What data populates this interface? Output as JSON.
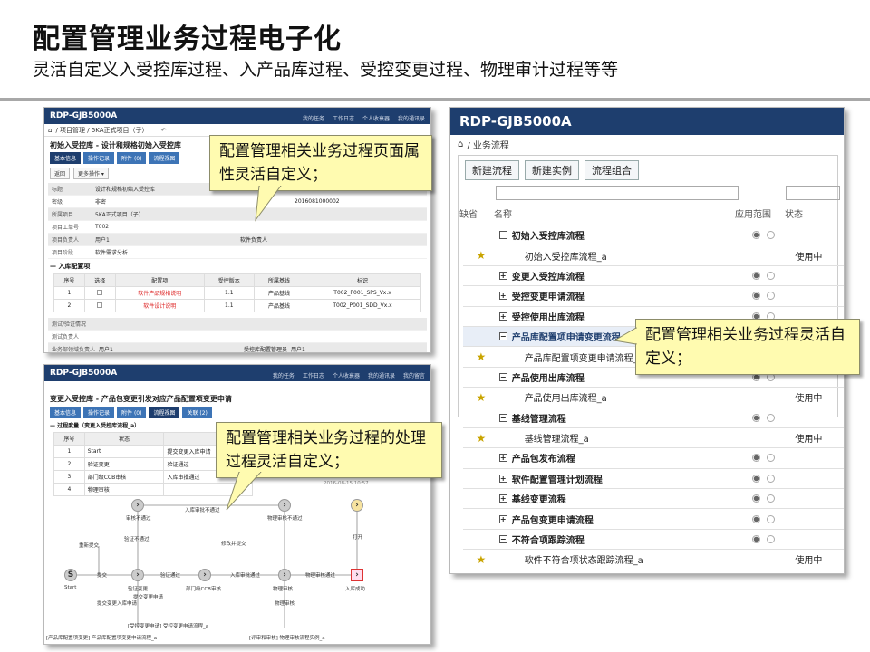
{
  "slide": {
    "title": "配置管理业务过程电子化",
    "subtitle": "灵活自定义入受控库过程、入产品库过程、受控变更过程、物理审计过程等等"
  },
  "app": {
    "name": "RDP-GJB5000A",
    "nav": [
      "我的任务",
      "工作日志",
      "个人收衰器",
      "我的通讯录",
      "我的留言"
    ]
  },
  "s1": {
    "crumb": "/ 项目管理 / 5KA正式项目（子）",
    "title": "初始入受控库 - 设计和规格初始入受控库",
    "tabs": [
      "基本信息",
      "操作记录",
      "附件 (0)",
      "流程视图"
    ],
    "buttons": [
      "返回",
      "更多操作 ▾"
    ],
    "fields": [
      {
        "label": "标题",
        "value": "设计和规格初始入受控库"
      },
      {
        "label": "密级",
        "value": "非密",
        "extra": "2016081000002"
      },
      {
        "label": "所属项目",
        "value": "5KA正式项目（子）"
      },
      {
        "label": "项目工单号",
        "value": "T002"
      },
      {
        "label": "项目负责人",
        "value": "用户1",
        "r_label": "软件负责人"
      },
      {
        "label": "项目阶段",
        "value": "软件需求分析"
      }
    ],
    "section": "入库配置项",
    "table": {
      "headers": [
        "序号",
        "选择",
        "配置项",
        "受控版本",
        "所属基线",
        "标识"
      ],
      "rows": [
        [
          "1",
          "",
          "软件产品规格说明",
          "1.1",
          "产品基线",
          "T002_P001_SPS_Vx.x"
        ],
        [
          "2",
          "",
          "软件设计说明",
          "1.1",
          "产品基线",
          "T002_P001_SDD_Vx.x"
        ]
      ]
    },
    "foot": [
      {
        "label": "测试/验证情况"
      },
      {
        "label": "测试负责人"
      },
      {
        "label": "业务部领域负责人",
        "value": "用户1",
        "r_label": "受控库配置管理员",
        "r_value": "用户1"
      }
    ]
  },
  "s2": {
    "title": "变更入受控库 - 产品包变更引发对应产品配置项变更申请",
    "tabs": [
      "基本信息",
      "操作记录",
      "附件 (0)",
      "流程视图",
      "关联 (2)"
    ],
    "section": "过程度量（变更入受控库流程_a）",
    "table": {
      "headers": [
        "序号",
        "状态"
      ],
      "rows": [
        [
          "1",
          "Start",
          "提交变更入库申请"
        ],
        [
          "2",
          "验证变更",
          "验证通过"
        ],
        [
          "3",
          "部门级CCB审核",
          "入库审批通过"
        ],
        [
          "4",
          "物理审核",
          ""
        ]
      ]
    },
    "ts": "2016-08-15 10:57",
    "flow": [
      "审核不通过",
      "入库审批不通过",
      "物理审核不通过",
      "重新提交",
      "验证不通过",
      "修改并提交",
      "打开",
      "提交",
      "验证通过",
      "入库审批通过",
      "物理审核通过",
      "Start",
      "验证变更",
      "部门级CCB审核",
      "物理审核",
      "入库成功",
      "提交变更申请",
      "提交变更入库申请",
      "物理审核",
      "[受控变更申请] 受控变更申请流程_a",
      "[评审和审核] 物理审核流程实例_a",
      "[产品库配置项变更] 产品库配置项变更申请流程_a"
    ]
  },
  "s3": {
    "crumb": "/ 业务流程",
    "buttons": [
      "新建流程",
      "新建实例",
      "流程组合"
    ],
    "headers": [
      "缺省",
      "名称",
      "应用范围",
      "状态"
    ],
    "rows": [
      {
        "name": "初始入受控库流程",
        "group": true,
        "exp": "−",
        "radio": true
      },
      {
        "name": "初始入受控库流程_a",
        "star": true,
        "status": "使用中"
      },
      {
        "name": "变更入受控库流程",
        "group": true,
        "exp": "+",
        "radio": true
      },
      {
        "name": "受控变更申请流程",
        "group": true,
        "exp": "+",
        "radio": true
      },
      {
        "name": "受控使用出库流程",
        "group": true,
        "exp": "+",
        "radio": true
      },
      {
        "name": "产品库配置项申请变更流程",
        "group": true,
        "exp": "−",
        "sel": true
      },
      {
        "name": "产品库配置项变更申请流程_a",
        "star": true
      },
      {
        "name": "产品使用出库流程",
        "group": true,
        "exp": "−",
        "radio": true
      },
      {
        "name": "产品使用出库流程_a",
        "star": true,
        "status": "使用中"
      },
      {
        "name": "基线管理流程",
        "group": true,
        "exp": "−",
        "radio": true
      },
      {
        "name": "基线管理流程_a",
        "star": true,
        "status": "使用中"
      },
      {
        "name": "产品包发布流程",
        "group": true,
        "exp": "+",
        "radio": true
      },
      {
        "name": "软件配置管理计划流程",
        "group": true,
        "exp": "+",
        "radio": true
      },
      {
        "name": "基线变更流程",
        "group": true,
        "exp": "+",
        "radio": true
      },
      {
        "name": "产品包变更申请流程",
        "group": true,
        "exp": "+",
        "radio": true
      },
      {
        "name": "不符合项跟踪流程",
        "group": true,
        "exp": "−",
        "radio": true
      },
      {
        "name": "软件不符合项状态跟踪流程_a",
        "star": true,
        "status": "使用中"
      }
    ]
  },
  "callouts": {
    "c1": "配置管理相关业务过程页面属性灵活自定义；",
    "c2": "配置管理相关业务过程的处理过程灵活自定义；",
    "c3": "配置管理相关业务过程灵活自定义；"
  }
}
